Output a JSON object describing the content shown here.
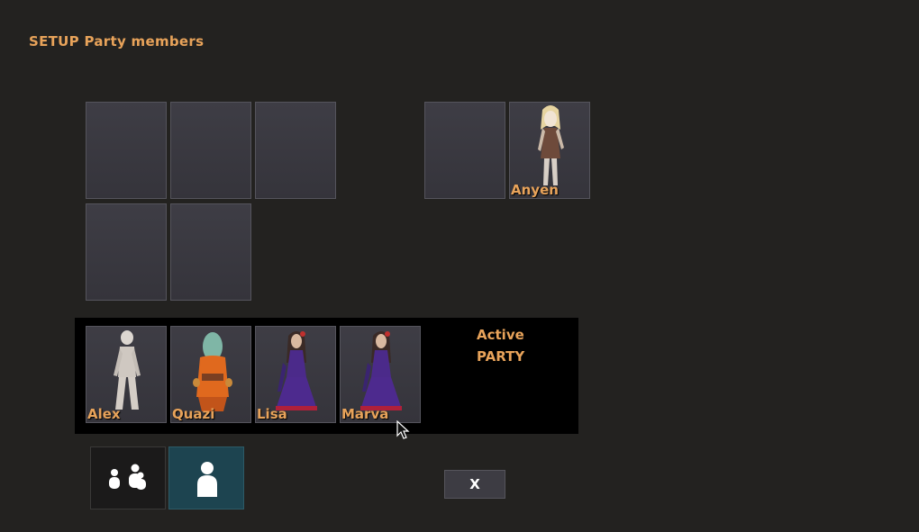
{
  "header": {
    "title": "SETUP Party members"
  },
  "reserve": {
    "slots": [
      {
        "name": ""
      },
      {
        "name": ""
      },
      {
        "name": ""
      },
      {
        "name": ""
      },
      {
        "name": ""
      }
    ]
  },
  "side": {
    "slots": [
      {
        "name": ""
      },
      {
        "name": "Anyen",
        "character": "blonde-girl-figure"
      }
    ]
  },
  "party": {
    "label_line1": "Active",
    "label_line2": "PARTY",
    "members": [
      {
        "name": "Alex",
        "character": "white-humanoid-figure"
      },
      {
        "name": "Quazi",
        "character": "orange-robed-creature-figure"
      },
      {
        "name": "Lisa",
        "character": "purple-dress-woman-figure"
      },
      {
        "name": "Marva",
        "character": "purple-dress-woman-figure"
      }
    ]
  },
  "buttons": {
    "group_icon": "group-icon",
    "single_icon": "person-icon",
    "close_label": "X"
  },
  "colors": {
    "accent": "#e8a35a",
    "background": "#232220",
    "selected_button": "#1d4450"
  }
}
